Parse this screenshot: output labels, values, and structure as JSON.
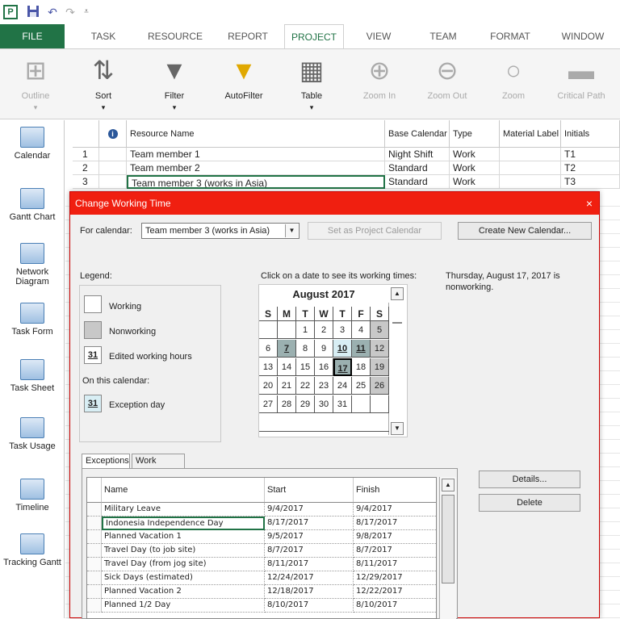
{
  "qat": {
    "app_icon": "P",
    "save_icon": "save-icon",
    "undo_icon": "undo-icon",
    "redo_icon": "redo-icon",
    "customize_icon": "customize-qat-icon"
  },
  "tabs": [
    "FILE",
    "TASK",
    "RESOURCE",
    "REPORT",
    "PROJECT",
    "VIEW",
    "TEAM",
    "FORMAT",
    "WINDOW"
  ],
  "active_tab": "PROJECT",
  "ribbon": [
    {
      "label": "Outline",
      "icon": "outline-icon",
      "disabled": true,
      "has_arrow": true
    },
    {
      "label": "Sort",
      "icon": "sort-icon",
      "disabled": false,
      "has_arrow": true
    },
    {
      "label": "Filter",
      "icon": "filter-icon",
      "disabled": false,
      "has_arrow": true
    },
    {
      "label": "AutoFilter",
      "icon": "autofilter-icon",
      "disabled": false,
      "has_arrow": false
    },
    {
      "label": "Table",
      "icon": "table-icon",
      "disabled": false,
      "has_arrow": true
    },
    {
      "label": "Zoom In",
      "icon": "zoom-in-icon",
      "disabled": true,
      "has_arrow": false
    },
    {
      "label": "Zoom Out",
      "icon": "zoom-out-icon",
      "disabled": true,
      "has_arrow": false
    },
    {
      "label": "Zoom",
      "icon": "zoom-icon",
      "disabled": true,
      "has_arrow": false
    },
    {
      "label": "Critical Path",
      "icon": "critical-path-icon",
      "disabled": true,
      "has_arrow": false
    }
  ],
  "sidebar": [
    "Calendar",
    "Gantt Chart",
    "Network Diagram",
    "Task Form",
    "Task Sheet",
    "Task Usage",
    "Timeline",
    "Tracking Gantt"
  ],
  "sheet": {
    "headers": {
      "info": "i",
      "name": "Resource Name",
      "base_calendar": "Base Calendar",
      "type": "Type",
      "material_label": "Material Label",
      "initials": "Initials"
    },
    "rows": [
      {
        "id": "1",
        "name": "Team member 1",
        "base_calendar": "Night Shift",
        "type": "Work",
        "initials": "T1"
      },
      {
        "id": "2",
        "name": "Team member 2",
        "base_calendar": "Standard",
        "type": "Work",
        "initials": "T2"
      },
      {
        "id": "3",
        "name": "Team member 3 (works in Asia)",
        "base_calendar": "Standard",
        "type": "Work",
        "initials": "T3"
      }
    ]
  },
  "dialog": {
    "title": "Change Working Time",
    "close": "×",
    "for_calendar_label": "For calendar:",
    "calendar_value": "Team member 3 (works in Asia)",
    "set_project_calendar": "Set as Project Calendar",
    "create_new_calendar": "Create New Calendar...",
    "legend_title": "Legend:",
    "legend": {
      "working": "Working",
      "nonworking": "Nonworking",
      "edited": "Edited working hours",
      "edited_num": "31",
      "on_this_calendar": "On this calendar:",
      "exception": "Exception day",
      "exception_num": "31"
    },
    "click_hint": "Click on a date to see its working times:",
    "info_text": "Thursday, August 17, 2017 is nonworking.",
    "calendar": {
      "month": "August 2017",
      "weekdays": [
        "S",
        "M",
        "T",
        "W",
        "T",
        "F",
        "S"
      ],
      "weeks": [
        [
          "",
          "",
          "1",
          "2",
          "3",
          "4",
          "5"
        ],
        [
          "6",
          "7",
          "8",
          "9",
          "10",
          "11",
          "12"
        ],
        [
          "13",
          "14",
          "15",
          "16",
          "17",
          "18",
          "19"
        ],
        [
          "20",
          "21",
          "22",
          "23",
          "24",
          "25",
          "26"
        ],
        [
          "27",
          "28",
          "29",
          "30",
          "31",
          "",
          ""
        ]
      ],
      "nonworking": [
        "5",
        "12",
        "19",
        "26"
      ],
      "edited": [
        "7",
        "11",
        "17"
      ],
      "exception": [
        "10"
      ],
      "selected": "17"
    },
    "tab_exceptions": "Exceptions",
    "tab_work_weeks": "Work Weeks",
    "exceptions_headers": {
      "name": "Name",
      "start": "Start",
      "finish": "Finish"
    },
    "exceptions": [
      {
        "name": "Military Leave",
        "start": "9/4/2017",
        "finish": "9/4/2017"
      },
      {
        "name": "Indonesia Independence Day",
        "start": "8/17/2017",
        "finish": "8/17/2017"
      },
      {
        "name": "Planned Vacation 1",
        "start": "9/5/2017",
        "finish": "9/8/2017"
      },
      {
        "name": "Travel Day (to job site)",
        "start": "8/7/2017",
        "finish": "8/7/2017"
      },
      {
        "name": "Travel Day (from jog site)",
        "start": "8/11/2017",
        "finish": "8/11/2017"
      },
      {
        "name": "Sick Days (estimated)",
        "start": "12/24/2017",
        "finish": "12/29/2017"
      },
      {
        "name": "Planned Vacation 2",
        "start": "12/18/2017",
        "finish": "12/22/2017"
      },
      {
        "name": "Planned 1/2 Day",
        "start": "8/10/2017",
        "finish": "8/10/2017"
      }
    ],
    "details_button": "Details...",
    "delete_button": "Delete"
  },
  "colors": {
    "brand": "#217346",
    "dialog_title": "#f01f10"
  }
}
